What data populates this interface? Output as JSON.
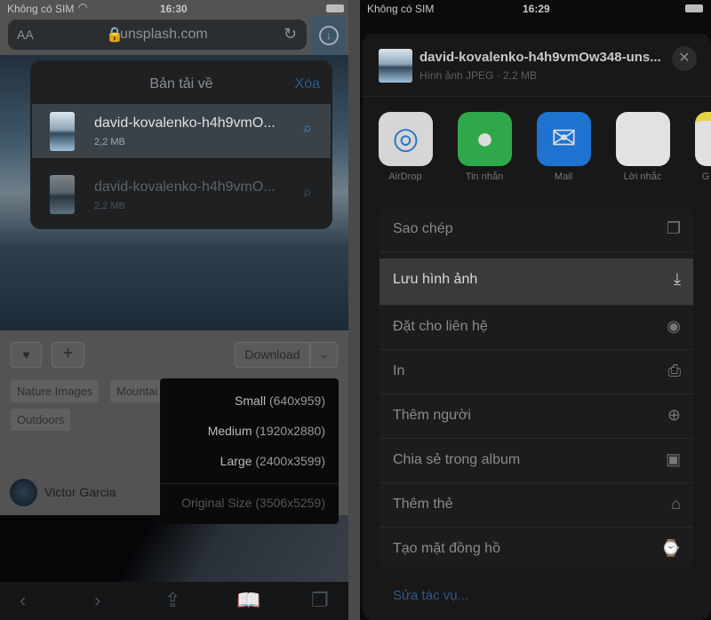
{
  "left": {
    "status": {
      "carrier": "Không có SIM",
      "time": "16:30"
    },
    "url": {
      "text_size": "AA",
      "domain": "unsplash.com"
    },
    "downloads": {
      "title": "Bản tải về",
      "clear": "Xóa",
      "items": [
        {
          "name": "david-kovalenko-h4h9vmO...",
          "size": "2,2 MB"
        },
        {
          "name": "david-kovalenko-h4h9vmO...",
          "size": "2,2 MB"
        }
      ]
    },
    "download_label": "Download",
    "tags": [
      "Nature Images",
      "Mountai",
      "Outdoors"
    ],
    "author": "Victor Garcia",
    "sizes": [
      {
        "label": "Small",
        "dim": "(640x959)"
      },
      {
        "label": "Medium",
        "dim": "(1920x2880)"
      },
      {
        "label": "Large",
        "dim": "(2400x3599)"
      },
      {
        "label": "Original Size",
        "dim": "(3506x5259)"
      }
    ]
  },
  "right": {
    "status": {
      "carrier": "Không có SIM",
      "time": "16:29"
    },
    "file": {
      "name": "david-kovalenko-h4h9vmOw348-uns...",
      "meta": "Hình ảnh JPEG · 2,2 MB"
    },
    "apps": [
      {
        "label": "AirDrop",
        "color": "#d9d9d9"
      },
      {
        "label": "Tin nhắn",
        "color": "#2fa84a"
      },
      {
        "label": "Mail",
        "color": "#1f73d0"
      },
      {
        "label": "Lời nhắc",
        "color": "#e8e8e8"
      },
      {
        "label": "G",
        "color": "#e8d24a"
      }
    ],
    "actions": [
      {
        "label": "Sao chép",
        "icon": "copy-icon",
        "glyph": "❐"
      },
      {
        "label": "Lưu hình ảnh",
        "icon": "save-image-icon",
        "glyph": "⤓"
      },
      {
        "label": "Đặt cho liên hệ",
        "icon": "contact-icon",
        "glyph": "◉"
      },
      {
        "label": "In",
        "icon": "print-icon",
        "glyph": "⎙"
      },
      {
        "label": "Thêm người",
        "icon": "add-person-icon",
        "glyph": "⊕"
      },
      {
        "label": "Chia sẻ trong album",
        "icon": "shared-album-icon",
        "glyph": "▣"
      },
      {
        "label": "Thêm thẻ",
        "icon": "tag-icon",
        "glyph": "⌂"
      },
      {
        "label": "Tạo mặt đồng hồ",
        "icon": "watch-icon",
        "glyph": "⌚"
      }
    ],
    "edit_actions": "Sửa tác vụ..."
  },
  "colors": {
    "accent": "#3a82c8"
  }
}
